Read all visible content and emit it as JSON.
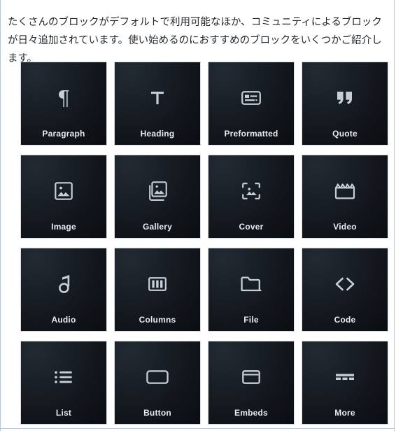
{
  "page": {
    "background_color": "#ffffff",
    "frame_color": "#b9c6d6"
  },
  "intro": {
    "text": "たくさんのブロックがデフォルトで利用可能なほか、コミュニティによるブロックが日々追加されています。使い始めるのにおすすめのブロックをいくつかご紹介します。",
    "text_color": "#23282d"
  },
  "block_grid": {
    "columns": 4,
    "rows": 4,
    "tile_background_top": "#222a33",
    "tile_background_bottom": "#0a0c10",
    "tile_border_color": "#d7dde4",
    "label_color": "#e7eaee",
    "icon_color": "#c8ced6",
    "tiles": [
      {
        "label": "Paragraph",
        "icon": "pilcrow-icon"
      },
      {
        "label": "Heading",
        "icon": "heading-t-icon"
      },
      {
        "label": "Preformatted",
        "icon": "preformatted-icon"
      },
      {
        "label": "Quote",
        "icon": "quote-marks-icon"
      },
      {
        "label": "Image",
        "icon": "image-icon"
      },
      {
        "label": "Gallery",
        "icon": "gallery-stack-icon"
      },
      {
        "label": "Cover",
        "icon": "cover-crop-icon"
      },
      {
        "label": "Video",
        "icon": "clapperboard-icon"
      },
      {
        "label": "Audio",
        "icon": "music-note-icon"
      },
      {
        "label": "Columns",
        "icon": "columns-icon"
      },
      {
        "label": "File",
        "icon": "folder-icon"
      },
      {
        "label": "Code",
        "icon": "angle-brackets-icon"
      },
      {
        "label": "List",
        "icon": "bulleted-list-icon"
      },
      {
        "label": "Button",
        "icon": "rounded-rect-icon"
      },
      {
        "label": "Embeds",
        "icon": "browser-window-icon"
      },
      {
        "label": "More",
        "icon": "more-dashes-icon"
      }
    ]
  }
}
